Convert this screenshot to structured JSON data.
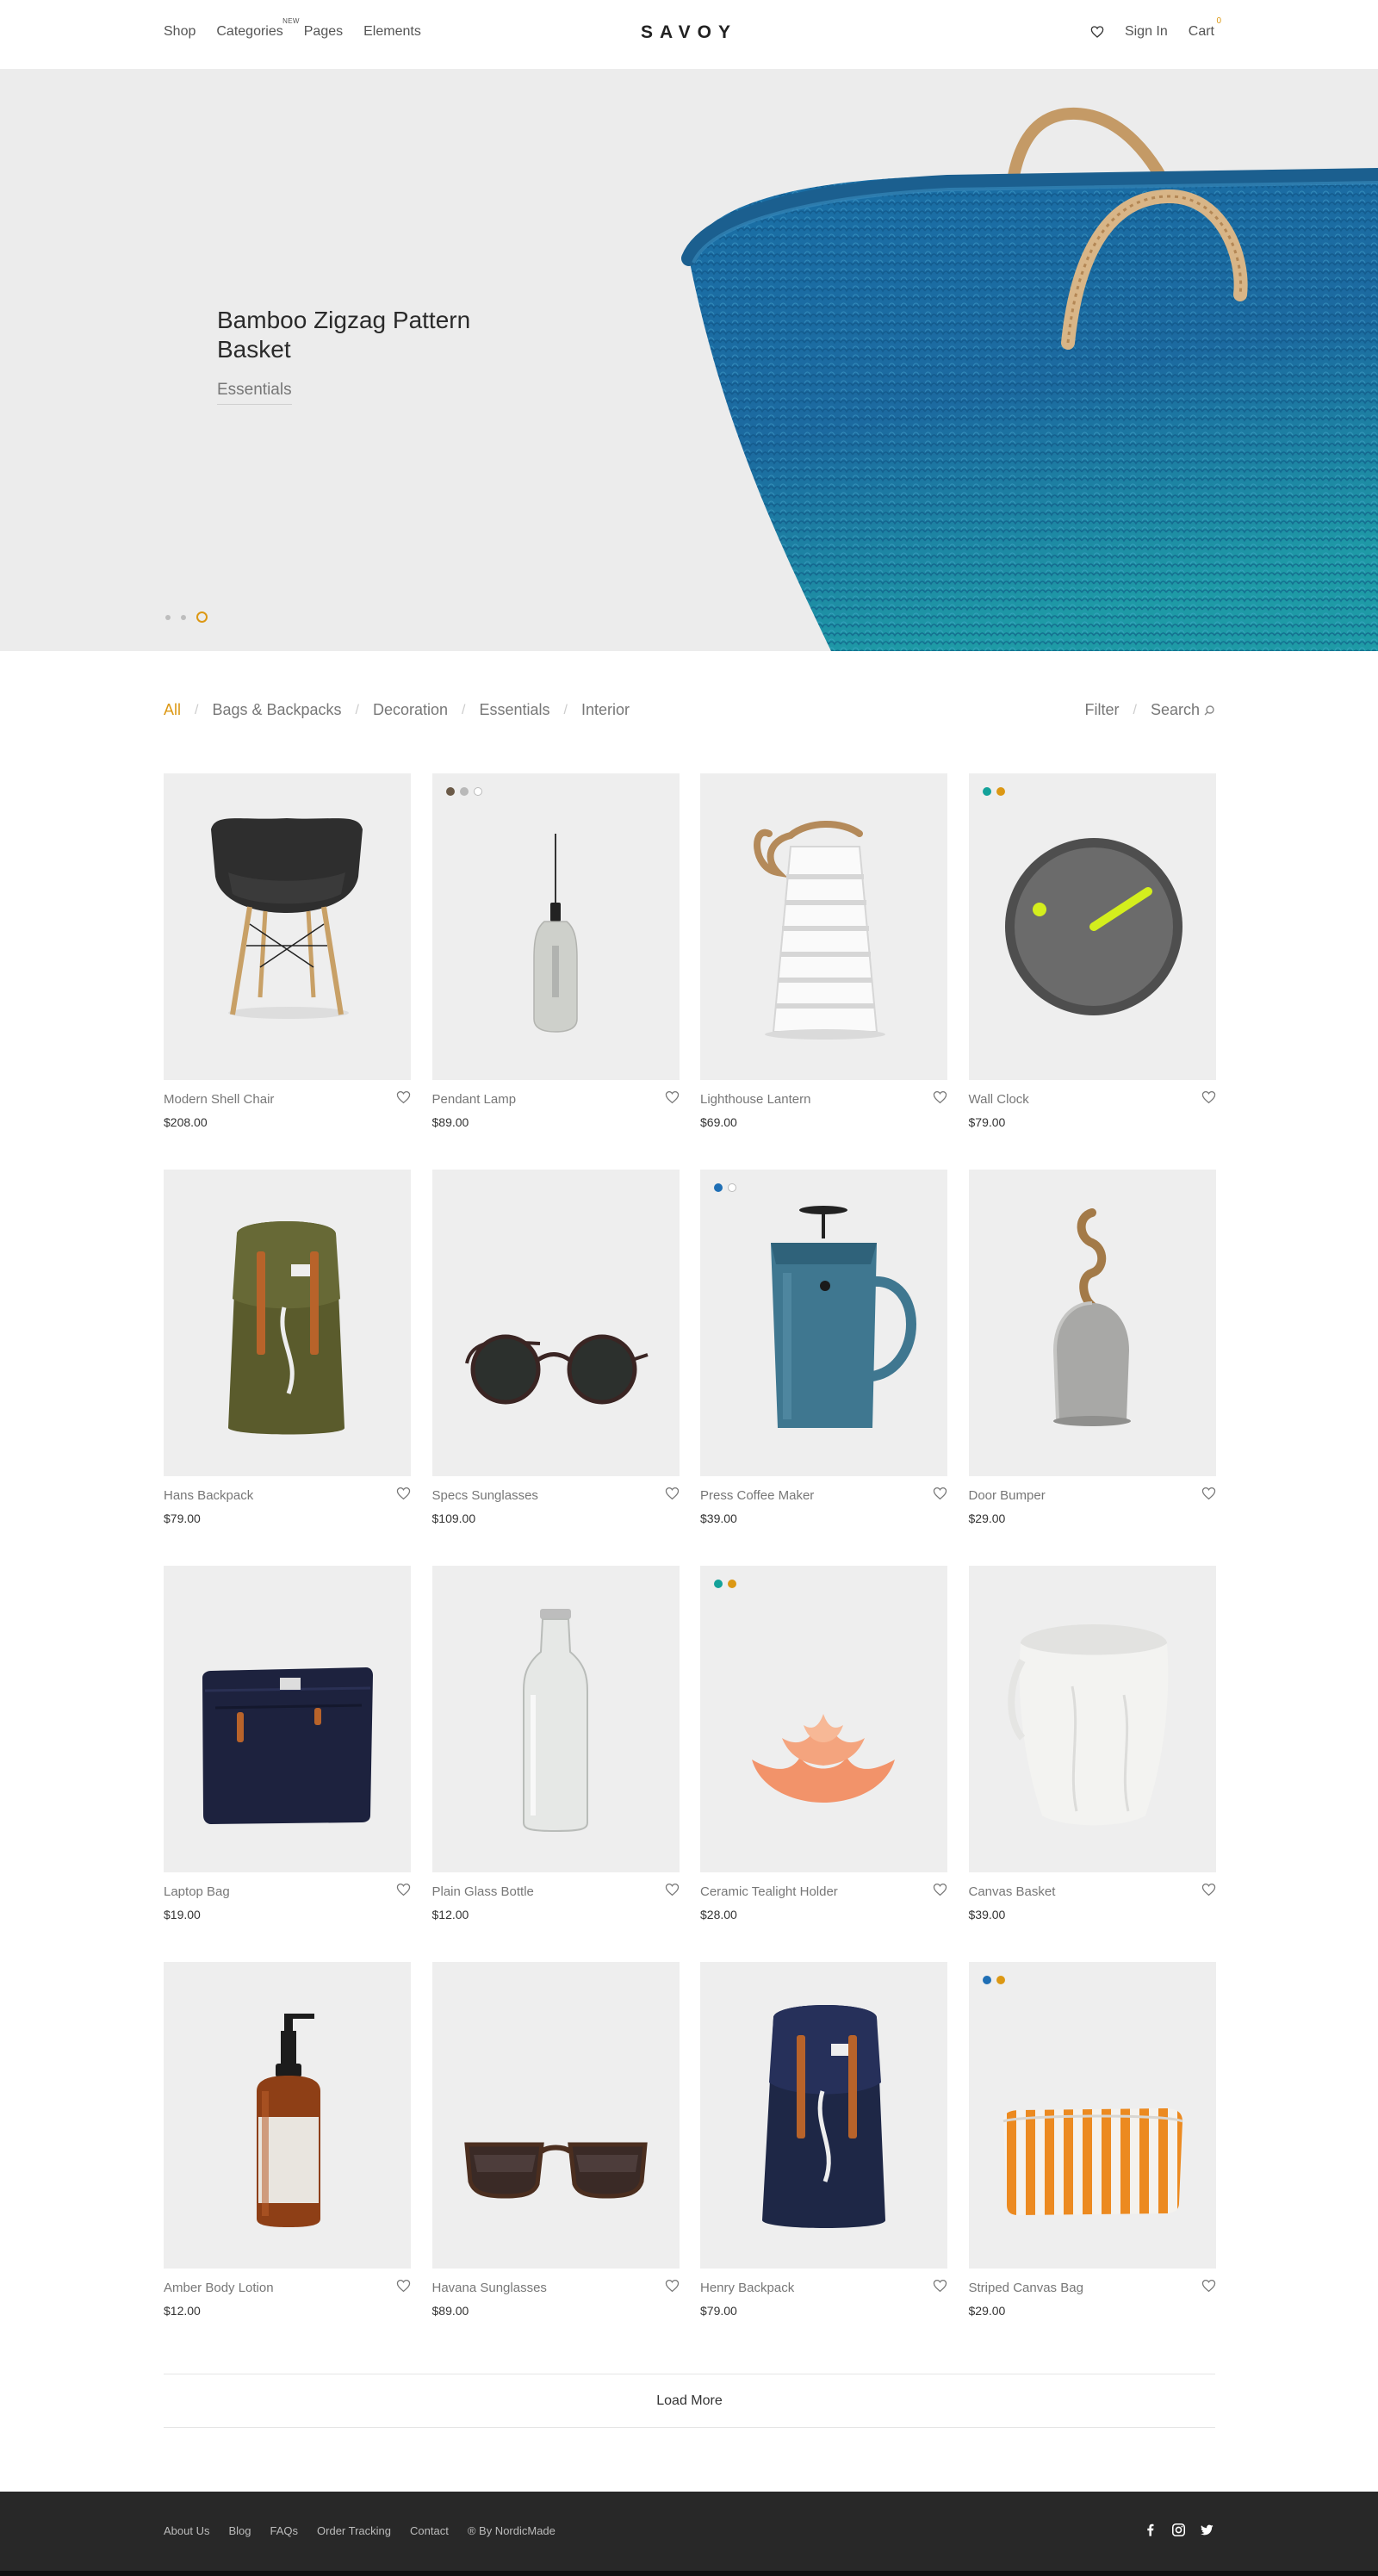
{
  "header": {
    "nav_left": [
      {
        "label": "Shop"
      },
      {
        "label": "Categories",
        "badge": "NEW"
      },
      {
        "label": "Pages"
      },
      {
        "label": "Elements"
      }
    ],
    "logo": "SAVOY",
    "sign_in": "Sign In",
    "cart_label": "Cart",
    "cart_count": "0",
    "wishlist_icon": "heart-icon"
  },
  "hero": {
    "title": "Bamboo Zigzag Pattern Basket",
    "tag": "Essentials",
    "slides": 3,
    "active_slide": 3,
    "accent_color": "#dc9814"
  },
  "filters": {
    "categories": [
      "All",
      "Bags & Backpacks",
      "Decoration",
      "Essentials",
      "Interior"
    ],
    "active": "All",
    "filter_label": "Filter",
    "search_label": "Search"
  },
  "products": [
    {
      "name": "Modern Shell Chair",
      "price": "$208.00",
      "swatches": []
    },
    {
      "name": "Pendant Lamp",
      "price": "$89.00",
      "swatches": [
        "#6b5a48",
        "#b9b9b9",
        "#ffffff"
      ]
    },
    {
      "name": "Lighthouse Lantern",
      "price": "$69.00",
      "swatches": []
    },
    {
      "name": "Wall Clock",
      "price": "$79.00",
      "swatches": [
        "#14a29a",
        "#dc9814"
      ]
    },
    {
      "name": "Hans Backpack",
      "price": "$79.00",
      "swatches": []
    },
    {
      "name": "Specs Sunglasses",
      "price": "$109.00",
      "swatches": []
    },
    {
      "name": "Press Coffee Maker",
      "price": "$39.00",
      "swatches": [
        "#1f6fb5",
        "#ffffff"
      ]
    },
    {
      "name": "Door Bumper",
      "price": "$29.00",
      "swatches": []
    },
    {
      "name": "Laptop Bag",
      "price": "$19.00",
      "swatches": []
    },
    {
      "name": "Plain Glass Bottle",
      "price": "$12.00",
      "swatches": []
    },
    {
      "name": "Ceramic Tealight Holder",
      "price": "$28.00",
      "swatches": [
        "#14a29a",
        "#dc9814"
      ]
    },
    {
      "name": "Canvas Basket",
      "price": "$39.00",
      "swatches": []
    },
    {
      "name": "Amber Body Lotion",
      "price": "$12.00",
      "swatches": []
    },
    {
      "name": "Havana Sunglasses",
      "price": "$89.00",
      "swatches": []
    },
    {
      "name": "Henry Backpack",
      "price": "$79.00",
      "swatches": []
    },
    {
      "name": "Striped Canvas Bag",
      "price": "$29.00",
      "swatches": [
        "#1f6fb5",
        "#dc9814"
      ]
    }
  ],
  "load_more": "Load More",
  "footer": {
    "links": [
      "About Us",
      "Blog",
      "FAQs",
      "Order Tracking",
      "Contact",
      "® By NordicMade"
    ],
    "social": [
      "facebook-icon",
      "instagram-icon",
      "twitter-icon"
    ]
  }
}
